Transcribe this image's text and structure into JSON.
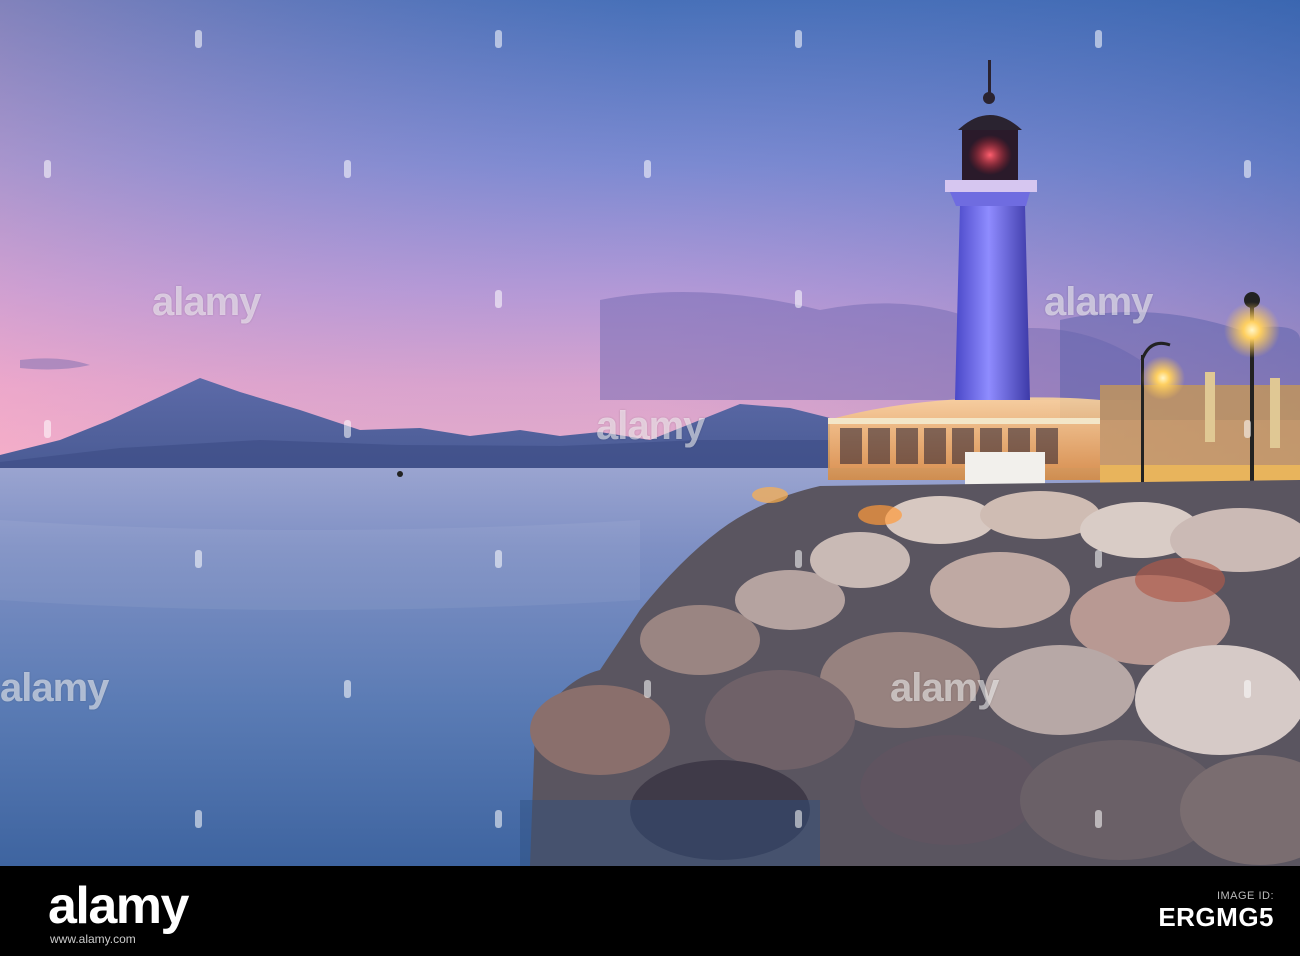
{
  "image": {
    "description_tags": [
      "lighthouse",
      "rocky-breakwater",
      "sea",
      "dusk",
      "mountains"
    ],
    "palette": {
      "sky_top": "#4f78b6",
      "sky_horizon": "#e8a6c4",
      "sea": "#5a7fb0",
      "lighthouse_glow": "#6c6cff",
      "lamp_glow": "#ffcf55",
      "rocks": "#8a7f7d"
    }
  },
  "watermarks": {
    "repeated_text": "alamy"
  },
  "footer": {
    "logo_text": "alamy",
    "image_id_label": "Image ID:",
    "image_id": "ERGMG5",
    "site": "www.alamy.com"
  }
}
